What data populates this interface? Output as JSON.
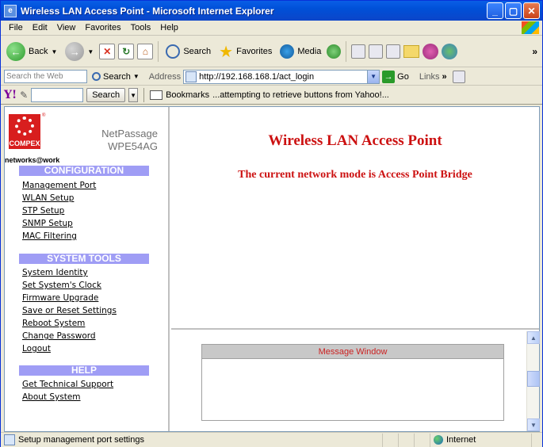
{
  "window": {
    "title": "Wireless LAN Access Point - Microsoft Internet Explorer"
  },
  "menubar": [
    "File",
    "Edit",
    "View",
    "Favorites",
    "Tools",
    "Help"
  ],
  "toolbar": {
    "back_label": "Back",
    "search_label": "Search",
    "favorites_label": "Favorites",
    "media_label": "Media"
  },
  "addressbar": {
    "web_search_placeholder": "Search the Web",
    "search_label": "Search",
    "address_label": "Address",
    "url": "http://192.168.168.1/act_login",
    "go_label": "Go",
    "links_label": "Links"
  },
  "yahoo": {
    "search_label": "Search",
    "bookmarks_label": "Bookmarks",
    "status_text": "...attempting to retrieve buttons from Yahoo!..."
  },
  "brand": {
    "logo_text": "COMPEX",
    "product_line1": "NetPassage",
    "product_line2": "WPE54AG",
    "tagline": "networks@work",
    "accent_color": "#9f9df5"
  },
  "nav": {
    "configuration": {
      "heading": "CONFIGURATION",
      "items": [
        "Management Port",
        "WLAN Setup",
        "STP Setup",
        "SNMP Setup",
        "MAC Filtering"
      ]
    },
    "system_tools": {
      "heading": "SYSTEM TOOLS",
      "items": [
        "System Identity",
        "Set System's Clock",
        "Firmware Upgrade",
        "Save or Reset Settings",
        "Reboot System",
        "Change Password",
        "Logout"
      ]
    },
    "help": {
      "heading": "HELP",
      "items": [
        "Get Technical Support",
        "About System"
      ]
    }
  },
  "main": {
    "heading": "Wireless LAN Access Point",
    "mode_text": "The current network mode is Access Point Bridge",
    "heading_color": "#cc1111"
  },
  "message_window": {
    "title": "Message Window",
    "body": ""
  },
  "statusbar": {
    "text": "Setup management port settings",
    "zone": "Internet"
  }
}
